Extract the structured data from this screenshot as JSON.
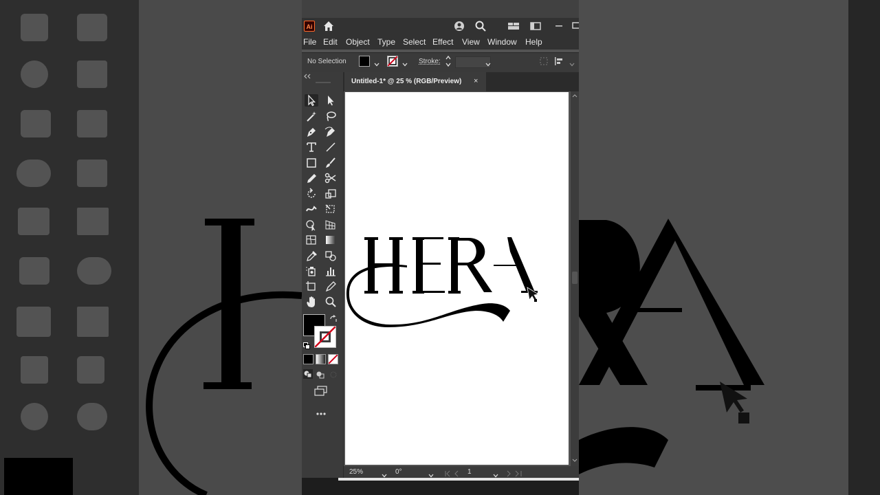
{
  "app": {
    "logo_text": "Ai",
    "accent": "#ff6a2a"
  },
  "menu": [
    "File",
    "Edit",
    "Object",
    "Type",
    "Select",
    "Effect",
    "View",
    "Window",
    "Help"
  ],
  "control_bar": {
    "selection_label": "No Selection",
    "stroke_label": "Stroke:",
    "fill_color": "#000000"
  },
  "document": {
    "tab_label": "Untitled-1* @ 25 % (RGB/Preview)",
    "close_glyph": "×"
  },
  "artwork": {
    "text": "HERA"
  },
  "status": {
    "zoom": "25%",
    "rotation": "0°",
    "artboard_number": "1"
  },
  "colors": {
    "panel": "#3b3b3b",
    "menubar": "#323232",
    "canvas": "#535353",
    "artboard": "#ffffff"
  }
}
